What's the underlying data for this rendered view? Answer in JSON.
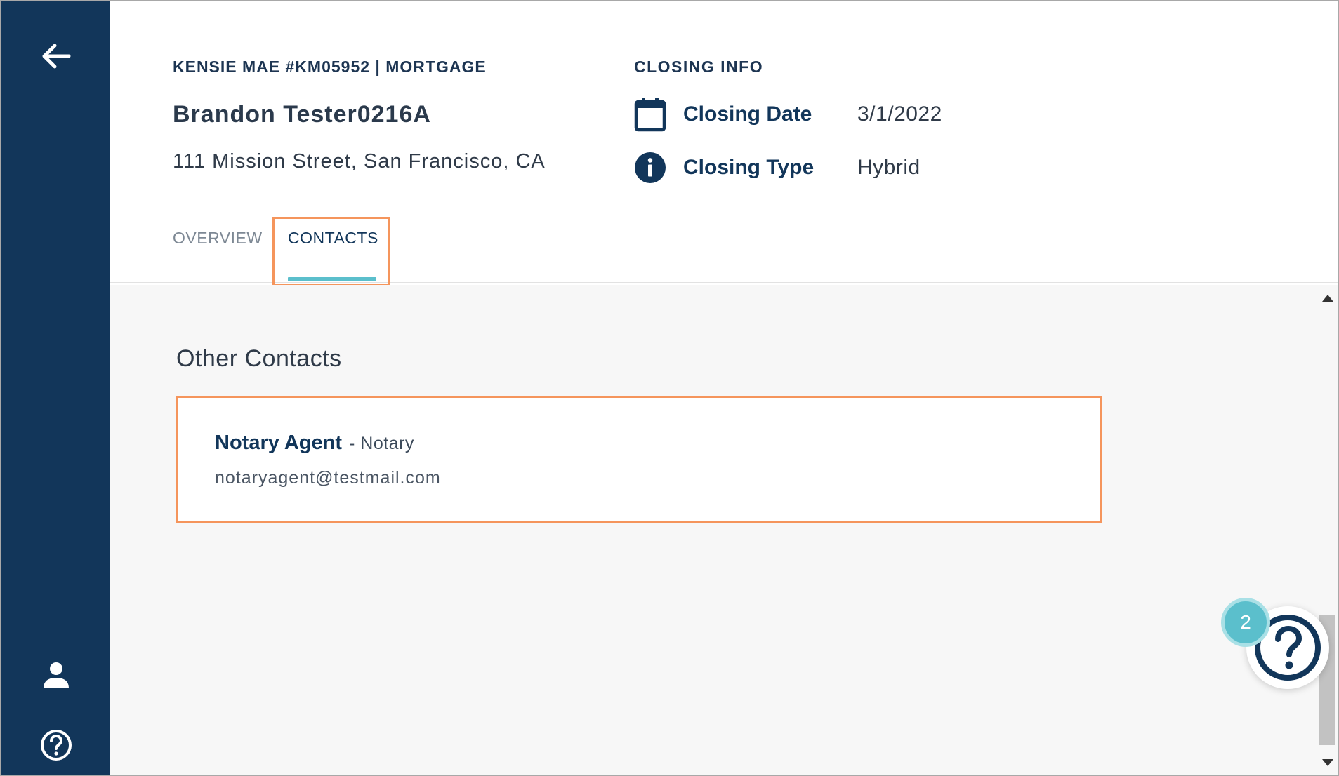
{
  "header": {
    "loan_title": "KENSIE MAE #KM05952 | MORTGAGE",
    "borrower_name": "Brandon Tester0216A",
    "address": "111 Mission Street, San Francisco, CA"
  },
  "closing_info": {
    "title": "CLOSING INFO",
    "date_label": "Closing Date",
    "date_value": "3/1/2022",
    "type_label": "Closing Type",
    "type_value": "Hybrid"
  },
  "tabs": [
    {
      "label": "OVERVIEW",
      "active": false
    },
    {
      "label": "CONTACTS",
      "active": true
    }
  ],
  "content": {
    "section_title": "Other Contacts",
    "contacts": [
      {
        "name": "Notary Agent",
        "role": "- Notary",
        "email": "notaryagent@testmail.com"
      }
    ]
  },
  "help_fab": {
    "badge_count": "2"
  },
  "colors": {
    "sidebar": "#12365a",
    "accent": "#5bbfcc",
    "highlight": "#f5955c"
  },
  "icons": {
    "back": "arrow-left-icon",
    "user": "user-icon",
    "help": "help-circle-icon",
    "calendar": "calendar-icon",
    "info": "info-icon"
  }
}
